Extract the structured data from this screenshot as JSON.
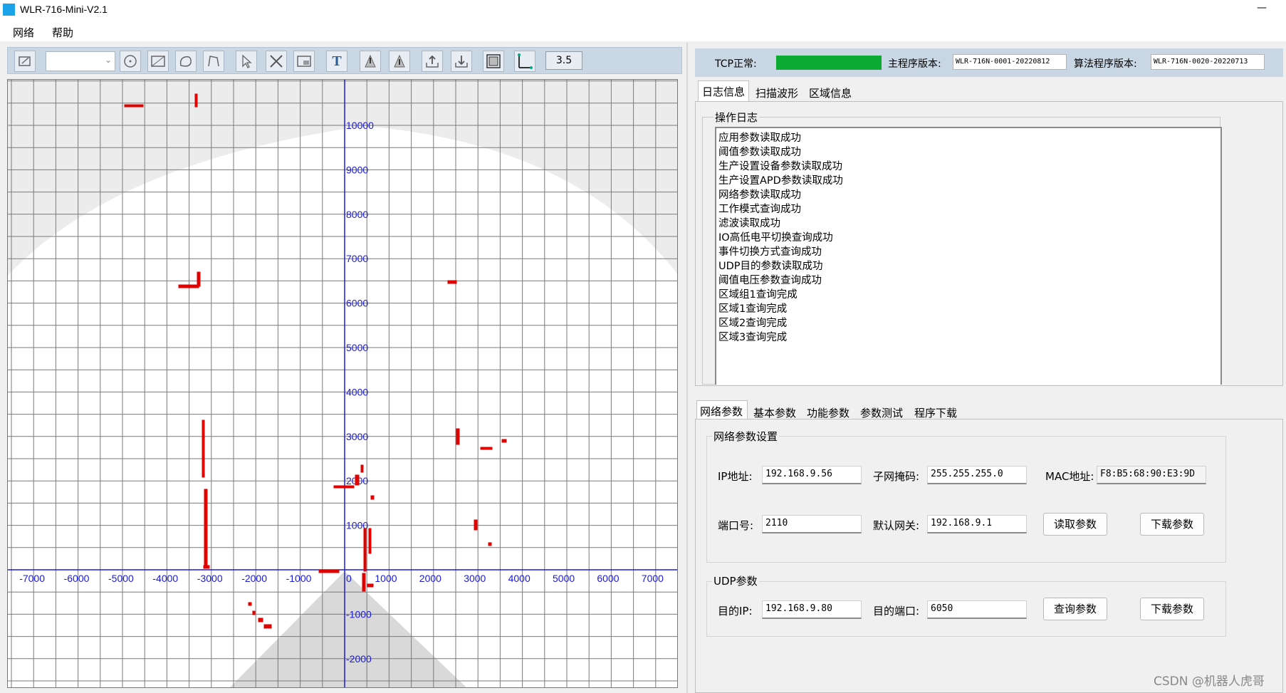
{
  "window": {
    "title": "WLR-716-Mini-V2.1",
    "minimize_glyph": "—"
  },
  "menu": [
    "网络",
    "帮助"
  ],
  "toolbar": {
    "icons": [
      "edit-icon",
      "circle-icon",
      "rectangle-icon",
      "polygon-icon",
      "line-icon",
      "select-icon",
      "delete-icon",
      "window-icon",
      "text-icon",
      "upload-area-icon",
      "download-area-icon",
      "import-icon",
      "export-icon",
      "fit-view-icon",
      "axis-icon"
    ],
    "text_glyph": "T",
    "zoom": "3.5"
  },
  "scan_view": {
    "x_labels": [
      "-7000",
      "-6000",
      "-5000",
      "-4000",
      "-3000",
      "-2000",
      "-1000",
      "0",
      "1000",
      "2000",
      "3000",
      "4000",
      "5000",
      "6000",
      "7000"
    ],
    "y_labels": [
      "10000",
      "9000",
      "8000",
      "7000",
      "6000",
      "5000",
      "4000",
      "3000",
      "2000",
      "1000",
      "-1000",
      "-2000"
    ],
    "point_color": "#e00000",
    "axis_color": "#1b1bd6"
  },
  "status": {
    "tcp_label": "TCP正常:",
    "tcp_color": "#0aaa33",
    "main_version_label": "主程序版本:",
    "main_version": "WLR-716N-0001-20220812",
    "algo_version_label": "算法程序版本:",
    "algo_version": "WLR-716N-0020-20220713"
  },
  "upper_tabs": [
    "日志信息",
    "扫描波形",
    "区域信息"
  ],
  "log": {
    "title": "操作日志",
    "lines": [
      "应用参数读取成功",
      "阈值参数读取成功",
      "生产设置设备参数读取成功",
      "生产设置APD参数读取成功",
      "网络参数读取成功",
      "工作模式查询成功",
      "滤波读取成功",
      "IO高低电平切换查询成功",
      "事件切换方式查询成功",
      "UDP目的参数读取成功",
      "阈值电压参数查询成功",
      "区域组1查询完成",
      "区域1查询完成",
      "区域2查询完成",
      "区域3查询完成"
    ]
  },
  "lower_tabs": [
    "网络参数",
    "基本参数",
    "功能参数",
    "参数测试",
    "程序下载"
  ],
  "network": {
    "title": "网络参数设置",
    "ip_label": "IP地址:",
    "ip": "192.168.9.56",
    "mask_label": "子网掩码:",
    "mask": "255.255.255.0",
    "mac_label": "MAC地址:",
    "mac": "F8:B5:68:90:E3:9D",
    "port_label": "端口号:",
    "port": "2110",
    "gateway_label": "默认网关:",
    "gateway": "192.168.9.1",
    "read_button": "读取参数",
    "download_button": "下载参数"
  },
  "udp": {
    "title": "UDP参数",
    "target_ip_label": "目的IP:",
    "target_ip": "192.168.9.80",
    "target_port_label": "目的端口:",
    "target_port": "6050",
    "query_button": "查询参数",
    "download_button": "下载参数"
  },
  "watermark": "CSDN @机器人虎哥"
}
